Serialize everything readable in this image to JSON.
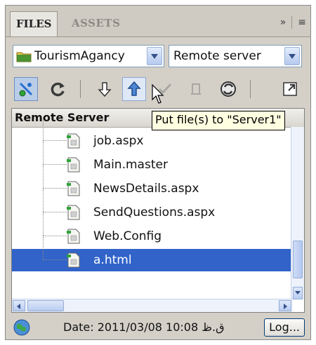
{
  "tabs": {
    "files": "FILES",
    "assets": "ASSETS"
  },
  "tabbar_controls": {
    "expand": "»",
    "menu": "≡"
  },
  "site_select": {
    "value": "TourismAgancy"
  },
  "location_select": {
    "value": "Remote server"
  },
  "tree": {
    "header": "Remote Server",
    "items": [
      {
        "name": "job.aspx"
      },
      {
        "name": "Main.master"
      },
      {
        "name": "NewsDetails.aspx"
      },
      {
        "name": "SendQuestions.aspx"
      },
      {
        "name": "Web.Config"
      },
      {
        "name": "a.html"
      }
    ],
    "selected_index": 5
  },
  "tooltip": "Put file(s) to \"Server1\"",
  "status": {
    "text": "Date: 2011/03/08 10:08 ق.ظ",
    "log_button": "Log..."
  },
  "colors": {
    "selection": "#3163c9",
    "panel": "#d4d0c8",
    "tooltip_bg": "#ffffe1"
  },
  "icons": {
    "toolbar": [
      "connect-icon",
      "refresh-icon",
      "get-files-icon",
      "put-files-icon",
      "checkout-icon",
      "checkin-icon",
      "synchronize-icon",
      "expand-panel-icon"
    ]
  }
}
